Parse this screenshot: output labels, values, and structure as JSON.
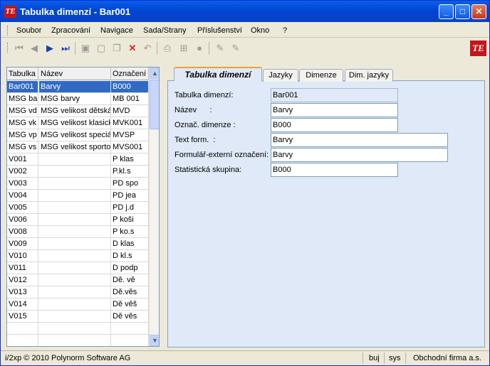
{
  "window": {
    "title": "Tabulka dimenzí - Bar001",
    "app_icon": "TE"
  },
  "menu": [
    "Soubor",
    "Zpracování",
    "Navigace",
    "Sada/Strany",
    "Příslušenství",
    "Okno",
    "?"
  ],
  "toolbar": {
    "icons": [
      "first-icon",
      "prev-icon",
      "next-icon",
      "last-icon",
      "save-icon",
      "new-icon",
      "copy-icon",
      "delete-icon",
      "undo-icon",
      "print-icon",
      "tree-icon",
      "stop-icon",
      "edit-icon",
      "edit2-icon"
    ],
    "brand_logo": "TE"
  },
  "grid": {
    "columns": [
      "Tabulka",
      "Název",
      "Označení"
    ],
    "rows": [
      [
        "Bar001",
        "Barvy",
        "B000"
      ],
      [
        "MSG ba",
        "MSG barvy",
        "MB 001"
      ],
      [
        "MSG vd",
        "MSG velikost dětská",
        "MVD"
      ],
      [
        "MSG vk",
        "MSG velikost klasick",
        "MVK001"
      ],
      [
        "MSG vp",
        "MSG velikost speciá",
        "MVSP"
      ],
      [
        "MSG vs",
        "MSG velikost sportov",
        "MVS001"
      ],
      [
        "V001",
        "",
        "P klas"
      ],
      [
        "V002",
        "",
        "P.kl.s"
      ],
      [
        "V003",
        "",
        "PD spo"
      ],
      [
        "V004",
        "",
        "PD jea"
      ],
      [
        "V005",
        "",
        "PD j.d"
      ],
      [
        "V006",
        "",
        "P koši"
      ],
      [
        "V008",
        "",
        "P ko.s"
      ],
      [
        "V009",
        "",
        "D klas"
      ],
      [
        "V010",
        "",
        "D kl.s"
      ],
      [
        "V011",
        "",
        "D podp"
      ],
      [
        "V012",
        "",
        "Dě. vě"
      ],
      [
        "V013",
        "",
        "Dě.věs"
      ],
      [
        "V014",
        "",
        "Dě věš"
      ],
      [
        "V015",
        "",
        "Dě věs"
      ],
      [
        "",
        "",
        ""
      ],
      [
        "",
        "",
        ""
      ]
    ],
    "selected_row": 0
  },
  "tabs": [
    "Tabulka dimenzí",
    "Jazyky",
    "Dimenze",
    "Dim. jazyky"
  ],
  "form": {
    "tabulka_label": "Tabulka dimenzí:",
    "tabulka_value": "Bar001",
    "nazev_label": "Název      :",
    "nazev_value": "Barvy",
    "oznac_label": "Označ. dimenze :",
    "oznac_value": "B000",
    "text_label": "Text form.  :",
    "text_value": "Barvy",
    "ext_label": "Formulář-externí označení:",
    "ext_value": "Barvy",
    "stat_label": "Statistická skupina:",
    "stat_value": "B000"
  },
  "status": {
    "copyright": "i/2xp © 2010 Polynorm Software AG",
    "user": "buj",
    "db": "sys",
    "company": "Obchodní firma a.s."
  }
}
